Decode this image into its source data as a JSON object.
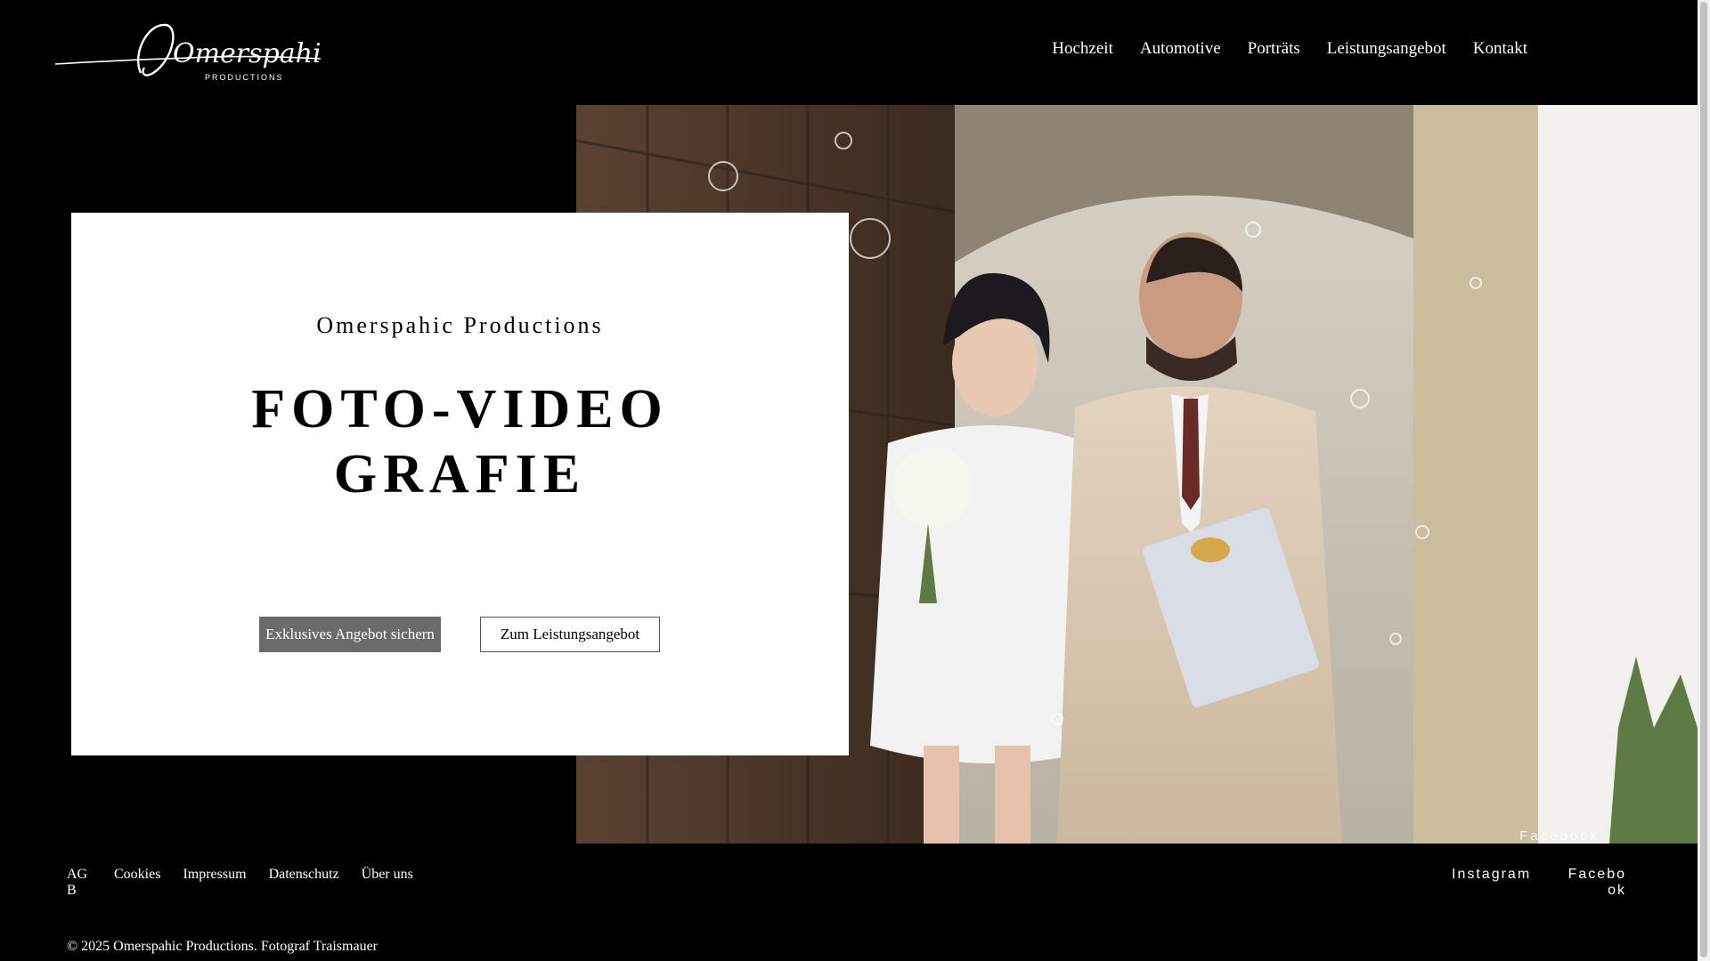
{
  "header": {
    "logo_text": "Omerspahic",
    "logo_subtext": "PRODUCTIONS",
    "nav": [
      "Hochzeit",
      "Automotive",
      "Porträts",
      "Leistungsangebot",
      "Kontakt"
    ]
  },
  "hero": {
    "subtitle": "Omerspahic Productions",
    "title_line1": "FOTO-VIDEO",
    "title_line2": "GRAFIE",
    "primary_button": "Exklusives Angebot sichern",
    "secondary_button": "Zum Leistungsangebot",
    "photo_caption": "Facebook"
  },
  "footer": {
    "links": [
      "AGB",
      "Cookies",
      "Impressum",
      "Datenschutz",
      "Über uns"
    ],
    "social": [
      "Instagram",
      "Facebook"
    ],
    "copyright": "© 2025 Omerspahic Productions. Fotograf Traismauer"
  },
  "colors": {
    "background": "#000000",
    "card": "#ffffff",
    "primary_button": "#6b6b6b"
  }
}
